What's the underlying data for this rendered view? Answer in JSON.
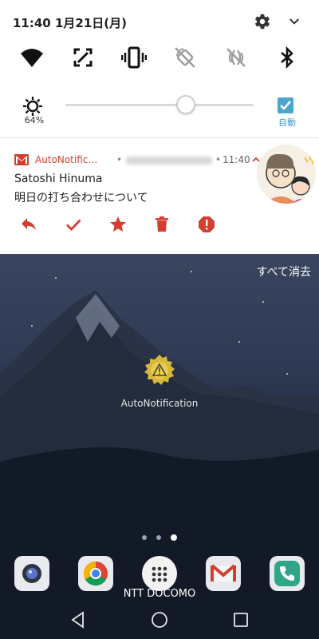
{
  "status_bar": {
    "time": "11:40",
    "date": "1月21日(月)"
  },
  "icons": {
    "settings": "gear-icon",
    "expand": "chevron-down-icon",
    "tiles": [
      "wifi-icon",
      "screen-capture-icon",
      "vibrate-icon",
      "rotation-lock-icon",
      "nfc-icon",
      "bluetooth-icon"
    ]
  },
  "brightness": {
    "percent_label": "64%",
    "level": 0.64,
    "auto_label": "自動",
    "auto_checked": true
  },
  "notification": {
    "app_name": "AutoNotific…",
    "time": "11:40",
    "sender": "Satoshi Hinuma",
    "subject": "明日の打ち合わせについて",
    "actions": [
      "reply-icon",
      "check-icon",
      "star-icon",
      "delete-icon",
      "report-icon"
    ],
    "accent_color": "#d23f31"
  },
  "wallpaper": {
    "clear_all": "すべて消去",
    "app_label": "AutoNotification",
    "carrier": "NTT DOCOMO",
    "dock": [
      "camera-icon",
      "chrome-icon",
      "app-drawer-icon",
      "gmail-icon",
      "phone-icon"
    ]
  },
  "nav": [
    "back-icon",
    "home-icon",
    "recents-icon"
  ]
}
